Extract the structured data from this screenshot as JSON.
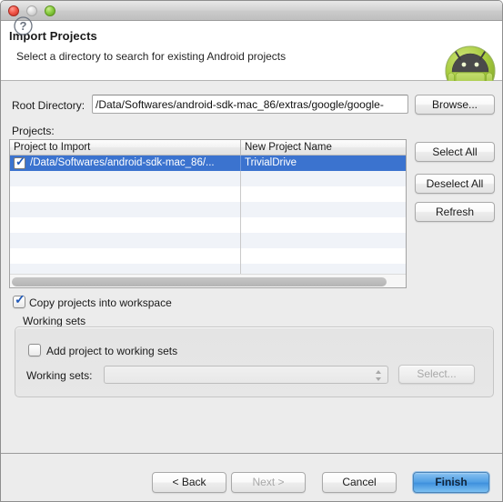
{
  "window": {
    "traffic_lights": [
      "close",
      "minimize",
      "zoom"
    ]
  },
  "header": {
    "title": "Import Projects",
    "description": "Select a directory to search for existing Android projects",
    "logo_icon": "android-robot-icon"
  },
  "form": {
    "root_directory_label": "Root Directory:",
    "root_directory_value": "/Data/Softwares/android-sdk-mac_86/extras/google/google-",
    "root_directory_placeholder": "",
    "projects_label": "Projects:",
    "browse_label": "Browse..."
  },
  "side_buttons": {
    "select_all": "Select All",
    "deselect_all": "Deselect All",
    "refresh": "Refresh"
  },
  "table": {
    "columns": [
      "Project to Import",
      "New Project Name"
    ],
    "rows": [
      {
        "checked": true,
        "selected": true,
        "project_to_import": "/Data/Softwares/android-sdk-mac_86/...",
        "new_project_name": "TrivialDrive"
      }
    ],
    "empty_row_count": 8,
    "scrollbar": "horizontal"
  },
  "options": {
    "copy_projects_label": "Copy projects into workspace",
    "copy_projects_checked": true
  },
  "working_sets": {
    "legend": "Working sets",
    "add_project_label": "Add project to working sets",
    "add_project_checked": false,
    "combo_label": "Working sets:",
    "combo_value": "",
    "select_label": "Select..."
  },
  "footer": {
    "help_icon": "question-mark-icon",
    "back": "< Back",
    "next": "Next >",
    "cancel": "Cancel",
    "finish": "Finish"
  },
  "colors": {
    "selection_blue": "#3b73cf",
    "default_button_blue": "#4e9ee4",
    "android_green": "#a4c639",
    "window_bg": "#ececec"
  }
}
